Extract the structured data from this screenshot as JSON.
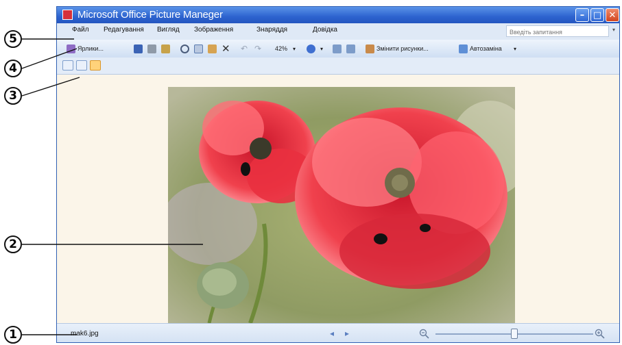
{
  "window": {
    "title": "Microsoft Office Picture Maneger",
    "min": "–",
    "max": "□",
    "close": "✕"
  },
  "menu": {
    "items": [
      "Файл",
      "Редагування",
      "Вигляд",
      "Зображення",
      "Знаряддя",
      "Довідка"
    ],
    "search_placeholder": "Введіть запитання",
    "dropdown_arrow": "▾"
  },
  "toolbar": {
    "shortcuts_label": "Ярлики...",
    "zoom": "42%",
    "zoom_arrow": "▾",
    "edit_pictures_label": "Змінити рисунки...",
    "autocorrect_label": "Автозаміна",
    "more": "▾",
    "icons": [
      "shortcuts-icon",
      "save-icon",
      "print-icon",
      "email-icon",
      "cut-icon",
      "copy-icon",
      "paste-icon",
      "delete-icon",
      "undo-icon",
      "redo-icon",
      "help-icon",
      "rotate-left-icon",
      "rotate-right-icon",
      "edit-pictures-icon",
      "autocorrect-icon"
    ]
  },
  "view_buttons": [
    "thumbnail-view-icon",
    "filmstrip-view-icon",
    "single-picture-view-icon"
  ],
  "status": {
    "file_name": "mak6.jpg",
    "prev": "◂",
    "next": "▸",
    "zoom_level": 0.5
  },
  "callouts": [
    "1",
    "2",
    "3",
    "4",
    "5"
  ],
  "colors": {
    "title_bar": "#2d63cf",
    "close_button": "#d2451f",
    "background": "#fbf5e9"
  }
}
